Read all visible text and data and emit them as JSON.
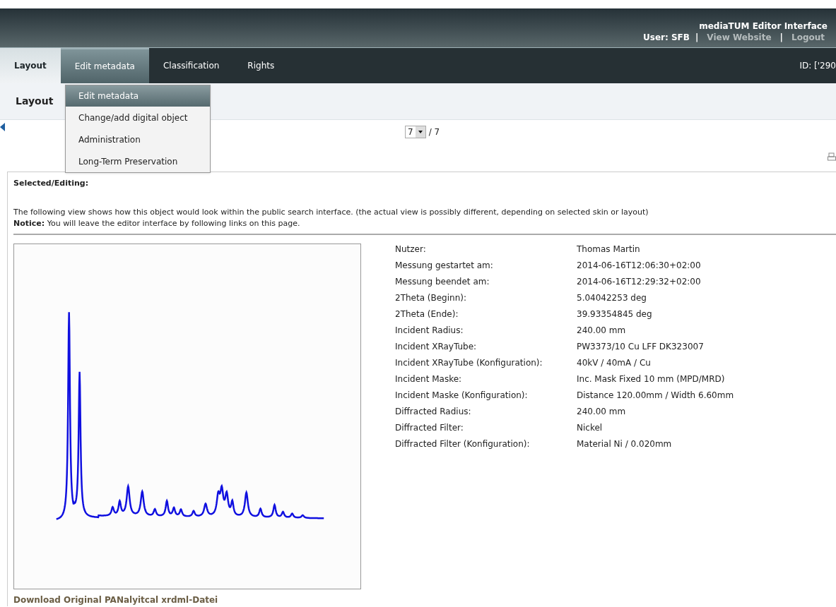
{
  "header": {
    "title": "mediaTUM Editor Interface",
    "items": [
      {
        "kind": "user",
        "text": "User: SFB"
      },
      {
        "kind": "separator",
        "text": "|"
      },
      {
        "kind": "link",
        "text": "View Website"
      },
      {
        "kind": "separator",
        "text": "|"
      },
      {
        "kind": "link",
        "text": "Logout"
      }
    ]
  },
  "nav": {
    "tabs": [
      {
        "label": "Layout",
        "selected": true,
        "open": false
      },
      {
        "label": "Edit metadata",
        "selected": false,
        "open": true
      },
      {
        "label": "Classification",
        "selected": false,
        "open": false
      },
      {
        "label": "Rights",
        "selected": false,
        "open": false
      }
    ],
    "id_text": "ID: ['290"
  },
  "menu": {
    "items": [
      {
        "label": "Edit metadata",
        "highlighted": true
      },
      {
        "label": "Change/add digital object",
        "highlighted": false
      },
      {
        "label": "Administration",
        "highlighted": false
      },
      {
        "label": "Long-Term Preservation",
        "highlighted": false
      }
    ]
  },
  "heading": "Layout",
  "pager": {
    "value": "7",
    "total": "/ 7"
  },
  "section_title": "Selected/Editing:",
  "description": "The following view shows how this object would look within the public search interface. (the actual view is possibly different, depending on selected skin or layout)",
  "notice": "**Notice:** You will leave the editor interface by following links on this page.",
  "metadata": [
    {
      "label": "Nutzer:",
      "value": "Thomas Martin"
    },
    {
      "label": "Messung gestartet am:",
      "value": "2014-06-16T12:06:30+02:00"
    },
    {
      "label": "Messung beendet am:",
      "value": "2014-06-16T12:29:32+02:00"
    },
    {
      "label": "2Theta (Beginn):",
      "value": "5.04042253 deg"
    },
    {
      "label": "2Theta (Ende):",
      "value": "39.93354845 deg"
    },
    {
      "label": "Incident Radius:",
      "value": "240.00 mm"
    },
    {
      "label": "Incident XRayTube:",
      "value": "PW3373/10 Cu LFF DK323007"
    },
    {
      "label": "Incident XRayTube (Konfiguration):",
      "value": "40kV / 40mA / Cu"
    },
    {
      "label": "Incident Maske:",
      "value": "Inc. Mask Fixed 10 mm (MPD/MRD)"
    },
    {
      "label": "Incident Maske (Konfiguration):",
      "value": "Distance 120.00mm / Width 6.60mm"
    },
    {
      "label": "Diffracted Radius:",
      "value": "240.00 mm"
    },
    {
      "label": "Diffracted Filter:",
      "value": "Nickel"
    },
    {
      "label": "Diffracted Filter (Konfiguration):",
      "value": "Material Ni / 0.020mm"
    }
  ],
  "download_link": "Download Original PANalyitcal xrdml-Datei"
}
